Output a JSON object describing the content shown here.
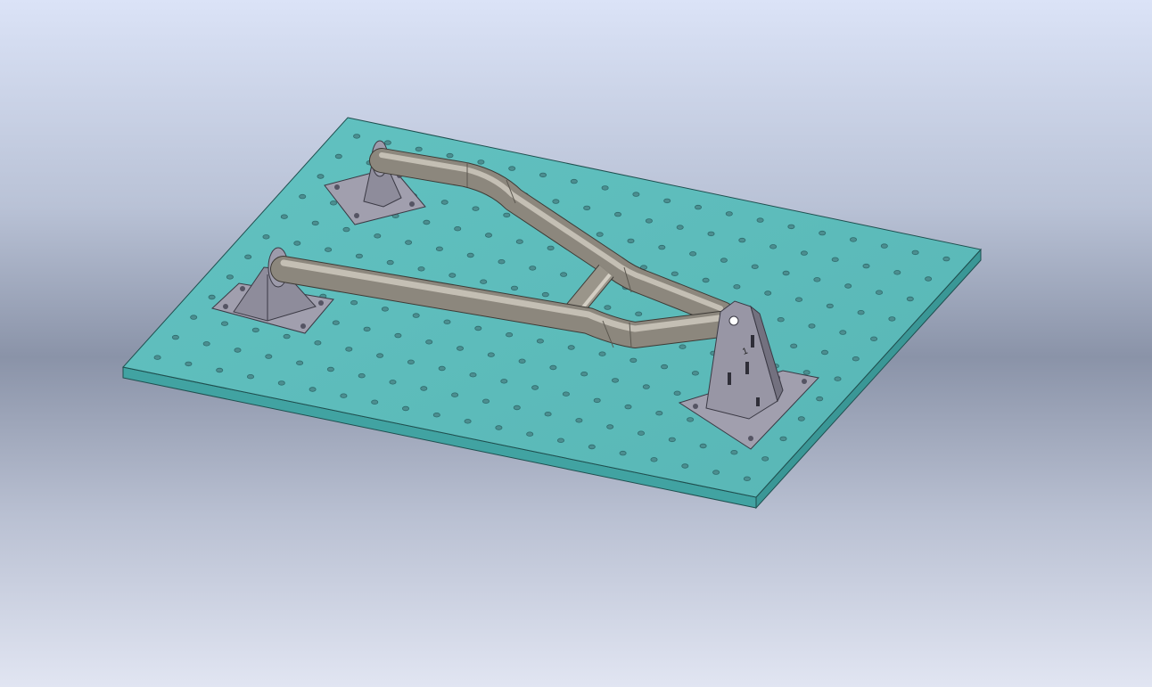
{
  "viewport": {
    "background_top": "#dbe3f7",
    "background_mid": "#8a93a8",
    "background_bottom": "#e1e5f2"
  },
  "model": {
    "plate": {
      "top_color": "#5fbdbc",
      "edge_color": "#3f9e9e",
      "outline_color": "#1f4f4f",
      "hole_color": "#4c8e90"
    },
    "tube": {
      "color": "#8c877d",
      "highlight": "#c9c4b9",
      "shadow": "#5e5a53"
    },
    "bracket": {
      "color": "#9b99a8",
      "dark": "#6a6877",
      "outline": "#3a3944"
    },
    "bracket_text": "1"
  }
}
